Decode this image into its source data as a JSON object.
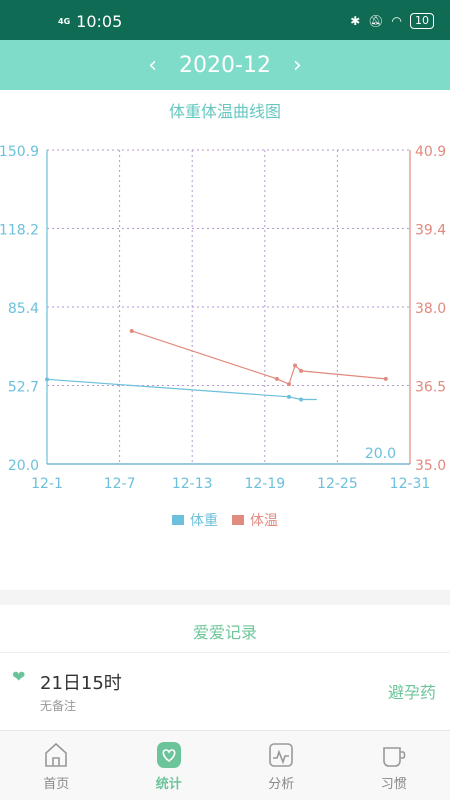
{
  "status": {
    "network": "4G",
    "time": "10:05",
    "battery": "10"
  },
  "header": {
    "month": "2020-12"
  },
  "chart_data": {
    "type": "line",
    "title": "体重体温曲线图",
    "x_ticks": [
      "12-1",
      "12-7",
      "12-13",
      "12-19",
      "12-25",
      "12-31"
    ],
    "left_axis": {
      "ticks": [
        "150.9",
        "118.2",
        "85.4",
        "52.7",
        "20.0"
      ],
      "min": 20.0,
      "max": 150.9,
      "color": "#6cc0dc"
    },
    "right_axis": {
      "ticks": [
        "40.9",
        "39.4",
        "38.0",
        "36.5",
        "35.0"
      ],
      "min": 35.0,
      "max": 40.9,
      "color": "#e08a80"
    },
    "annotation": "20.0",
    "series": [
      {
        "name": "体重",
        "color": "#6cc0dc",
        "axis": "left",
        "points": [
          {
            "x": 1,
            "y": 55.3
          },
          {
            "x": 21,
            "y": 48.0
          },
          {
            "x": 22,
            "y": 46.9
          },
          {
            "x": 23.3,
            "y": 46.9
          }
        ]
      },
      {
        "name": "体温",
        "color": "#e08a80",
        "axis": "right",
        "points": [
          {
            "x": 8,
            "y": 37.5
          },
          {
            "x": 20,
            "y": 36.6
          },
          {
            "x": 21,
            "y": 36.5
          },
          {
            "x": 21.5,
            "y": 36.85
          },
          {
            "x": 22,
            "y": 36.75
          },
          {
            "x": 29,
            "y": 36.6
          }
        ]
      }
    ]
  },
  "legend": [
    {
      "label": "体重",
      "color": "#6cc0dc"
    },
    {
      "label": "体温",
      "color": "#e08a80"
    }
  ],
  "record_section": {
    "title": "爱爱记录",
    "items": [
      {
        "date": "21日15时",
        "note": "无备注",
        "method": "避孕药"
      }
    ]
  },
  "tabs": [
    {
      "label": "首页",
      "icon": "home-icon",
      "active": false
    },
    {
      "label": "统计",
      "icon": "heart-chart-icon",
      "active": true
    },
    {
      "label": "分析",
      "icon": "analysis-icon",
      "active": false
    },
    {
      "label": "习惯",
      "icon": "cup-icon",
      "active": false
    }
  ]
}
